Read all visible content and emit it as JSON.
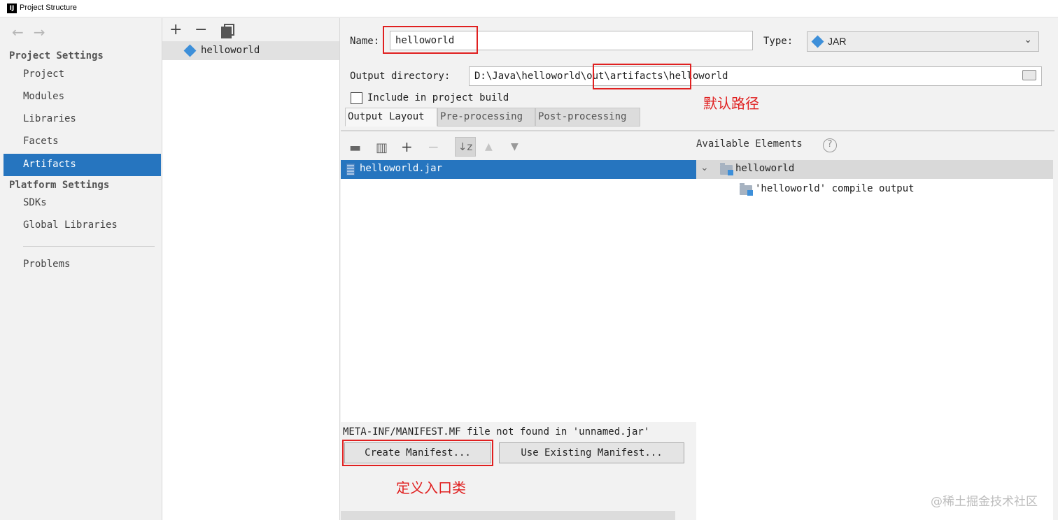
{
  "window": {
    "title": "Project Structure",
    "app_icon": "intellij-icon"
  },
  "nav": {
    "back": "←",
    "forward": "→",
    "project_settings_header": "Project Settings",
    "items": [
      "Project",
      "Modules",
      "Libraries",
      "Facets",
      "Artifacts"
    ],
    "platform_settings_header": "Platform Settings",
    "platform_items": [
      "SDKs",
      "Global Libraries"
    ],
    "problems": "Problems",
    "selected": "Artifacts"
  },
  "artifacts_list": {
    "add": "+",
    "remove": "−",
    "items": [
      {
        "label": "helloworld",
        "icon": "artifact-icon"
      }
    ]
  },
  "main": {
    "name_label": "Name:",
    "name_value": "helloworld",
    "type_label": "Type:",
    "type_value": "JAR",
    "output_dir_label": "Output directory:",
    "output_dir_value": "D:\\Java\\helloworld\\out\\artifacts\\helloworld",
    "include_label": "Include in project build",
    "include_checked": false,
    "tabs": [
      "Output Layout",
      "Pre-processing",
      "Post-processing"
    ],
    "active_tab": "Output Layout",
    "layout_tree": [
      {
        "label": "helloworld.jar",
        "icon": "jar-icon"
      }
    ],
    "available_label": "Available Elements",
    "available_tree": [
      {
        "label": "helloworld",
        "icon": "module-folder-icon",
        "expanded": true
      },
      {
        "label": "'helloworld' compile output",
        "icon": "module-folder-icon"
      }
    ],
    "manifest_message": "META-INF/MANIFEST.MF file not found in 'unnamed.jar'",
    "create_manifest": "Create Manifest...",
    "use_existing_manifest": "Use Existing Manifest..."
  },
  "annotations": {
    "default_path": "默认路径",
    "define_entry": "定义入口类",
    "color": "#e02020"
  },
  "watermark": "@稀土掘金技术社区",
  "colors": {
    "selection": "#2675bf",
    "accent": "#3d8fd9"
  }
}
